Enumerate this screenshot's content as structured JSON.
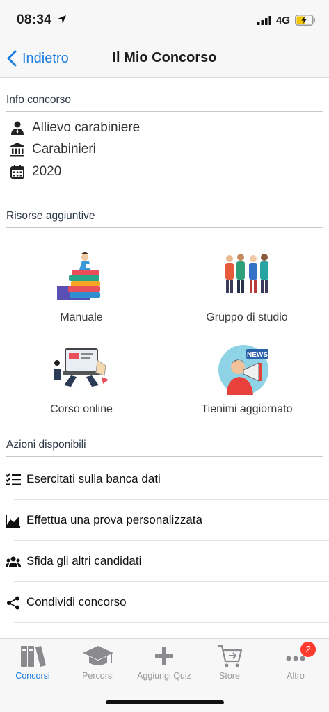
{
  "status": {
    "time": "08:34",
    "network": "4G"
  },
  "nav": {
    "back_label": "Indietro",
    "title": "Il Mio Concorso"
  },
  "info": {
    "header": "Info concorso",
    "rows": [
      {
        "icon": "person-icon",
        "text": "Allievo carabiniere"
      },
      {
        "icon": "institution-icon",
        "text": "Carabinieri"
      },
      {
        "icon": "calendar-icon",
        "text": "2020"
      }
    ]
  },
  "resources": {
    "header": "Risorse aggiuntive",
    "items": [
      {
        "icon": "books-illustration",
        "label": "Manuale"
      },
      {
        "icon": "students-illustration",
        "label": "Gruppo di studio"
      },
      {
        "icon": "laptop-illustration",
        "label": "Corso online"
      },
      {
        "icon": "news-megaphone-illustration",
        "label": "Tienimi aggiornato",
        "badge_text": "NEWS"
      }
    ]
  },
  "actions": {
    "header": "Azioni disponibili",
    "items": [
      {
        "icon": "checklist-icon",
        "label": "Esercitati sulla banca dati"
      },
      {
        "icon": "chart-icon",
        "label": "Effettua una prova personalizzata"
      },
      {
        "icon": "group-icon",
        "label": "Sfida gli altri candidati"
      },
      {
        "icon": "share-icon",
        "label": "Condividi concorso"
      }
    ]
  },
  "tabs": [
    {
      "icon": "books-icon",
      "label": "Concorsi",
      "active": true
    },
    {
      "icon": "graduation-cap-icon",
      "label": "Percorsi",
      "active": false
    },
    {
      "icon": "plus-icon",
      "label": "Aggiungi Quiz",
      "active": false
    },
    {
      "icon": "cart-icon",
      "label": "Store",
      "active": false
    },
    {
      "icon": "more-icon",
      "label": "Altro",
      "active": false,
      "badge": "2"
    }
  ],
  "colors": {
    "accent": "#1a7de0",
    "badge": "#ff3b30",
    "inactive": "#9b9b9f"
  }
}
